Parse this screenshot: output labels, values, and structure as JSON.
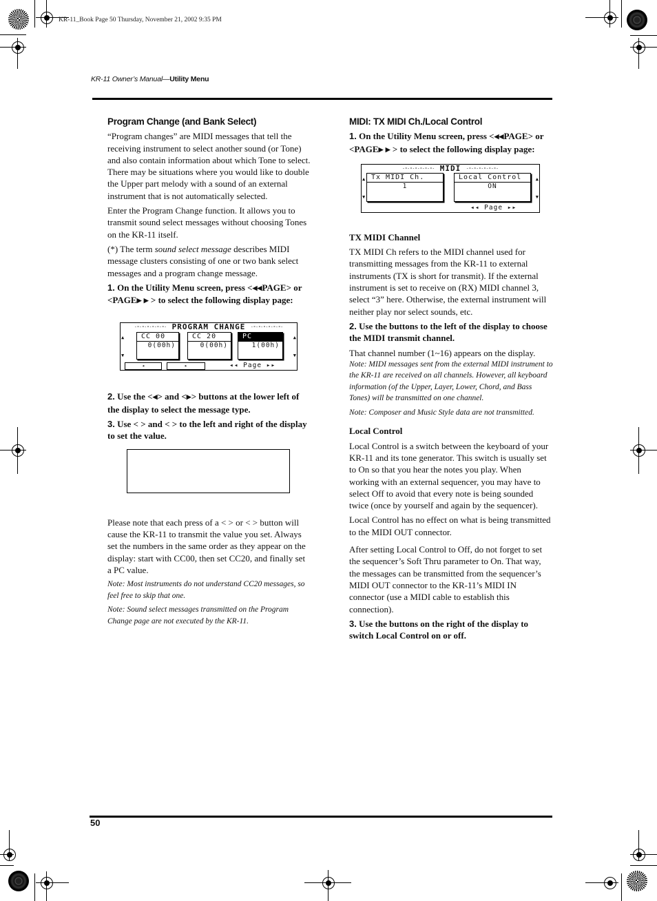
{
  "slug": "KR-11_Book  Page 50  Thursday, November 21, 2002  9:35 PM",
  "running_head": {
    "title_italic": "KR-11 Owner’s Manual",
    "dash": "—",
    "section": "Utility Menu"
  },
  "page_number": "50",
  "left": {
    "heading": "Program Change (and Bank Select)",
    "p1": "“Program changes” are MIDI messages that tell the receiving instrument to select another sound (or Tone) and also contain information about which Tone to select.  There may be situations where you would like to double the Upper part melody with a sound of an external instrument that is not automatically selected.",
    "p2": "Enter the Program Change function. It allows you to transmit sound select messages without choosing Tones on the KR-11 itself.",
    "p3_pre": "(*) The term ",
    "p3_em": "sound select message",
    "p3_post": " describes MIDI message clusters consisting of one or two bank select messages and a program change message.",
    "step1_num": "1.",
    "step1_a": " On the Utility Menu screen, press <",
    "step1_b": "PAGE> or <PAGE",
    "step1_c": " > to select the following display page:",
    "step2_num": "2.",
    "step2_a": " Use the <",
    "step2_b": "> and <",
    "step2_c": "> buttons at the lower left of the display to select the message type.",
    "step3_num": "3.",
    "step3_text": " Use <    > and <    > to the left and right of the display to set the value.",
    "p4": "Please note that each press of a <    > or <    > button will cause the KR-11 to transmit the value you set. Always set the numbers in the same order as they appear on the display: start with CC00, then set CC20, and finally set a PC value.",
    "note1": "Note: Most instruments do not understand CC20 messages, so feel free to skip that one.",
    "note2": "Note: Sound select messages transmitted on the Program Change page are not executed by the KR-11."
  },
  "lcd_program_change": {
    "title": "PROGRAM CHANGE",
    "boxes": [
      {
        "label": "CC 00",
        "value": "0(00h)",
        "selected": false
      },
      {
        "label": "CC 20",
        "value": "0(00h)",
        "selected": false
      },
      {
        "label": "PC",
        "value": "1(00h)",
        "selected": true
      }
    ],
    "btn_left": "◂",
    "btn_right": "▸",
    "page": "◂◂ Page ▸▸"
  },
  "right": {
    "heading": "MIDI: TX MIDI Ch./Local Control",
    "step1_num": "1.",
    "step1_a": " On the Utility Menu screen, press <",
    "step1_b": "PAGE> or <PAGE",
    "step1_c": " > to select the following display page:",
    "sub1": "TX MIDI Channel",
    "p1": "TX MIDI Ch refers to the MIDI channel used for transmitting messages from the KR-11 to external instruments (TX is short for transmit). If the external instrument is set to receive on (RX) MIDI channel 3, select “3” here. Otherwise, the external instrument will neither play nor select sounds, etc.",
    "step2_num": "2.",
    "step2_text": " Use the buttons to the left of the display to choose the MIDI transmit channel.",
    "p2": "That channel number (1~16) appears on the display.",
    "note1": "Note: MIDI messages sent from the external MIDI instrument to the KR-11 are received on all channels. However, all keyboard information (of the Upper, Layer, Lower, Chord, and Bass Tones) will be transmitted on one channel.",
    "note2": "Note: Composer and Music Style data are not transmitted.",
    "sub2": "Local Control",
    "p3": "Local Control is a switch between the keyboard of your KR-11 and its tone generator. This switch is usually set to On so that you hear the notes you play. When working with an external sequencer, you may have to select Off to avoid that every note is being sounded twice (once by yourself and again by the sequencer).",
    "p4": "Local Control has no effect on what is being transmitted to the MIDI OUT connector.",
    "p5": "After setting Local Control to Off, do not forget to set the sequencer’s Soft Thru parameter to On. That way, the messages can be transmitted from the sequencer’s MIDI OUT connector to the KR-11’s MIDI IN connector (use a MIDI cable to establish this connection).",
    "step3_num": "3.",
    "step3_text": " Use the buttons on the right of the display to switch Local Control on or off."
  },
  "lcd_midi": {
    "title": "MIDI",
    "boxes": [
      {
        "label": "Tx MIDI Ch.",
        "value": "1"
      },
      {
        "label": "Local Control",
        "value": "ON"
      }
    ],
    "page": "◂◂ Page ▸▸"
  },
  "symbols": {
    "tri_left": "◀",
    "tri_right": "▶",
    "dots": "-∘-∘-∘-∘-∘-∘-",
    "arrow_up": "▲",
    "arrow_down": "▼"
  }
}
